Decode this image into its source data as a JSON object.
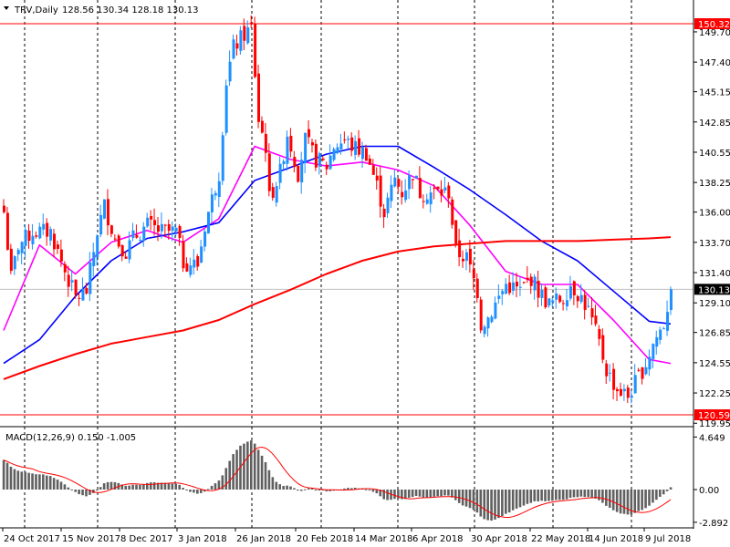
{
  "header": {
    "symbol_timeframe": "TRV,Daily",
    "ohlc": "128.56 130.34 128.18 130.13"
  },
  "colors": {
    "bull": "#1e90ff",
    "bear": "#ff0000",
    "ma_fast": "#ff00ff",
    "ma_mid": "#0000ff",
    "ma_slow": "#ff0000",
    "macd_hist": "#606060",
    "macd_signal": "#ff0000"
  },
  "chart_data": [
    {
      "type": "candlestick",
      "title": "TRV,Daily",
      "ylim": [
        119.95,
        150.32
      ],
      "y_ticks": [
        "149.70",
        "147.40",
        "145.15",
        "142.85",
        "140.55",
        "138.25",
        "136.00",
        "133.70",
        "131.40",
        "129.10",
        "126.85",
        "124.55",
        "122.25",
        "119.95"
      ],
      "high_line": {
        "label": "150.32",
        "value": 150.32
      },
      "low_line": {
        "label": "120.59",
        "value": 120.59
      },
      "current_price": {
        "label": "130.13",
        "value": 130.13
      },
      "bars_total": 187,
      "close_keypoints": [
        [
          0,
          136
        ],
        [
          2,
          131
        ],
        [
          4,
          133.5
        ],
        [
          8,
          134.5
        ],
        [
          13,
          134.5
        ],
        [
          17,
          131.5
        ],
        [
          20,
          129.5
        ],
        [
          23,
          130
        ],
        [
          26,
          134.5
        ],
        [
          28,
          136.5
        ],
        [
          31,
          134
        ],
        [
          34,
          133
        ],
        [
          36,
          134
        ],
        [
          40,
          135
        ],
        [
          44,
          134.5
        ],
        [
          48,
          134.5
        ],
        [
          50,
          132.2
        ],
        [
          54,
          132
        ],
        [
          56,
          135
        ],
        [
          60,
          139
        ],
        [
          62,
          146
        ],
        [
          64,
          148.5
        ],
        [
          67,
          149.5
        ],
        [
          69,
          150
        ],
        [
          71,
          143
        ],
        [
          73,
          141
        ],
        [
          74,
          137
        ],
        [
          77,
          139
        ],
        [
          79,
          142
        ],
        [
          82,
          139
        ],
        [
          84,
          141.5
        ],
        [
          87,
          140
        ],
        [
          90,
          139.5
        ],
        [
          92,
          141
        ],
        [
          95,
          141.5
        ],
        [
          97,
          141
        ],
        [
          101,
          140.5
        ],
        [
          104,
          138
        ],
        [
          106,
          136
        ],
        [
          109,
          138.5
        ],
        [
          111,
          137.5
        ],
        [
          114,
          139
        ],
        [
          116,
          137.5
        ],
        [
          120,
          137.5
        ],
        [
          124,
          137.5
        ],
        [
          126,
          133
        ],
        [
          129,
          132.5
        ],
        [
          132,
          130
        ],
        [
          133,
          127.5
        ],
        [
          135,
          128
        ],
        [
          138,
          129.5
        ],
        [
          140,
          130.5
        ],
        [
          144,
          130
        ],
        [
          147,
          131
        ],
        [
          149,
          130
        ],
        [
          152,
          129
        ],
        [
          156,
          129.5
        ],
        [
          158,
          130.5
        ],
        [
          161,
          129.5
        ],
        [
          163,
          128.5
        ],
        [
          166,
          126
        ],
        [
          168,
          124
        ],
        [
          171,
          122.5
        ],
        [
          174,
          122
        ],
        [
          176,
          123
        ],
        [
          179,
          124.5
        ],
        [
          181,
          126
        ],
        [
          184,
          127.5
        ],
        [
          186,
          130.13
        ]
      ],
      "ma_sample_bars": [
        0,
        10,
        20,
        30,
        40,
        50,
        60,
        70,
        80,
        90,
        100,
        110,
        120,
        130,
        140,
        150,
        160,
        170,
        180,
        186
      ],
      "series": [
        {
          "name": "MA fast (magenta)",
          "values": [
            127,
            133.5,
            131.3,
            133.7,
            134.6,
            133.7,
            135.5,
            141,
            140,
            139.5,
            139.8,
            139.2,
            138,
            135,
            131.5,
            130.5,
            130.5,
            127.8,
            124.8,
            124.5
          ]
        },
        {
          "name": "MA mid (blue)",
          "values": [
            124.5,
            126.3,
            129.6,
            132.3,
            134,
            134.5,
            135.2,
            138.4,
            139.4,
            140.4,
            141,
            141,
            139.4,
            137.7,
            135.8,
            133.8,
            132.3,
            130,
            127.7,
            127.5
          ]
        },
        {
          "name": "MA slow (red)",
          "values": [
            123.3,
            124.3,
            125.2,
            126,
            126.5,
            127,
            127.8,
            129,
            130.1,
            131.3,
            132.3,
            133,
            133.4,
            133.6,
            133.8,
            133.8,
            133.8,
            133.9,
            134,
            134.1
          ]
        }
      ]
    },
    {
      "type": "bar",
      "title": "MACD(12,26,9) 0.150 -1.005",
      "ylim": [
        -2.892,
        4.649
      ],
      "y_ticks": [
        "4.649",
        "0.00",
        "-2.892"
      ],
      "series": [
        {
          "name": "MACD histogram"
        },
        {
          "name": "Signal line"
        }
      ]
    }
  ],
  "x_axis": {
    "labels": [
      "24 Oct 2017",
      "15 Nov 2017",
      "8 Dec 2017",
      "3 Jan 2018",
      "26 Jan 2018",
      "20 Feb 2018",
      "14 Mar 2018",
      "6 Apr 2018",
      "30 Apr 2018",
      "22 May 2018",
      "14 Jun 2018",
      "9 Jul 2018"
    ]
  }
}
